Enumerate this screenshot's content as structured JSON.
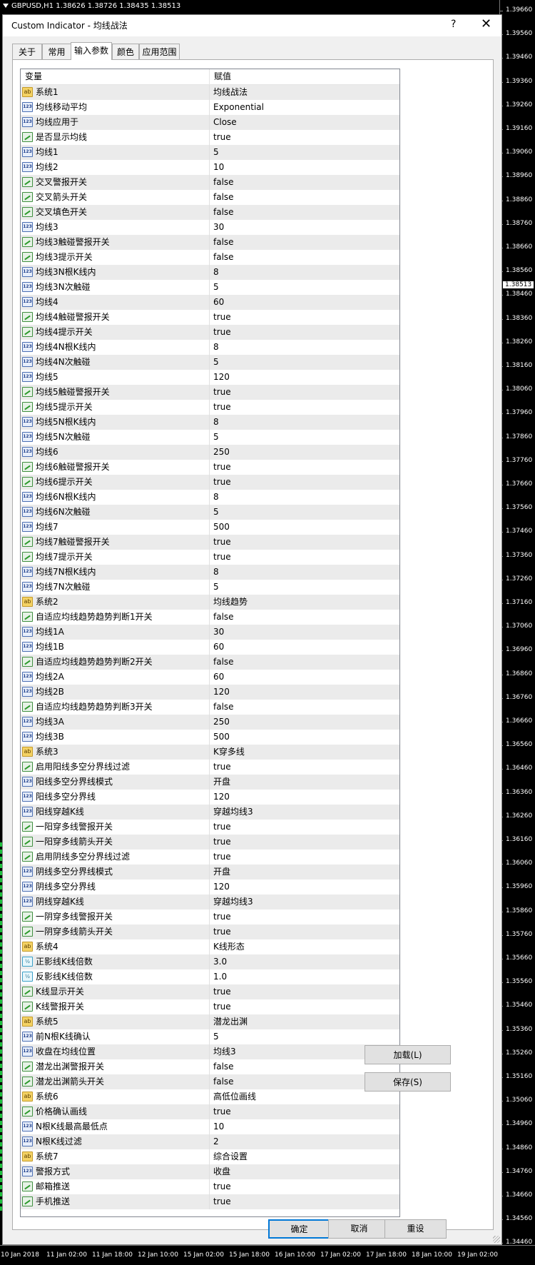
{
  "chart_header": "GBPUSD,H1  1.38626 1.38726 1.38435 1.38513",
  "price_axis": {
    "labels": [
      "1.39660",
      "1.39560",
      "1.39460",
      "1.39360",
      "1.39260",
      "1.39160",
      "1.39060",
      "1.38960",
      "1.38860",
      "1.38760",
      "1.38660",
      "1.38560",
      "1.38460",
      "1.38360",
      "1.38260",
      "1.38160",
      "1.38060",
      "1.37960",
      "1.37860",
      "1.37760",
      "1.37660",
      "1.37560",
      "1.37460",
      "1.37360",
      "1.37260",
      "1.37160",
      "1.37060",
      "1.36960",
      "1.36860",
      "1.36760",
      "1.36660",
      "1.36560",
      "1.36460",
      "1.36360",
      "1.36260",
      "1.36160",
      "1.36060",
      "1.35960",
      "1.35860",
      "1.35760",
      "1.35660",
      "1.35560",
      "1.35460",
      "1.35360",
      "1.35260",
      "1.35160",
      "1.35060",
      "1.34960",
      "1.34860",
      "1.34760",
      "1.34660",
      "1.34560",
      "1.34460"
    ],
    "current": "1.38513"
  },
  "time_axis": [
    "10 Jan 2018",
    "11 Jan 02:00",
    "11 Jan 18:00",
    "12 Jan 10:00",
    "15 Jan 02:00",
    "15 Jan 18:00",
    "16 Jan 10:00",
    "17 Jan 02:00",
    "17 Jan 18:00",
    "18 Jan 10:00",
    "19 Jan 02:00"
  ],
  "dialog": {
    "title": "Custom Indicator - 均线战法",
    "help": "?",
    "close": "✕",
    "tabs": [
      "关于",
      "常用",
      "输入参数",
      "颜色",
      "应用范围"
    ],
    "active_tab": 2,
    "columns": [
      "变量",
      "赋值"
    ],
    "rows": [
      {
        "icon": "ab",
        "name": "系统1",
        "value": "均线战法"
      },
      {
        "icon": "num",
        "name": "均线移动平均",
        "value": "Exponential"
      },
      {
        "icon": "num",
        "name": "均线应用于",
        "value": "Close"
      },
      {
        "icon": "bool",
        "name": "是否显示均线",
        "value": "true"
      },
      {
        "icon": "num",
        "name": "均线1",
        "value": "5"
      },
      {
        "icon": "num",
        "name": "均线2",
        "value": "10"
      },
      {
        "icon": "bool",
        "name": "交叉警报开关",
        "value": "false"
      },
      {
        "icon": "bool",
        "name": "交叉箭头开关",
        "value": "false"
      },
      {
        "icon": "bool",
        "name": "交叉填色开关",
        "value": "false"
      },
      {
        "icon": "num",
        "name": "均线3",
        "value": "30"
      },
      {
        "icon": "bool",
        "name": "均线3触碰警报开关",
        "value": "false"
      },
      {
        "icon": "bool",
        "name": "均线3提示开关",
        "value": "false"
      },
      {
        "icon": "num",
        "name": "均线3N根K线内",
        "value": "8"
      },
      {
        "icon": "num",
        "name": "均线3N次触碰",
        "value": "5"
      },
      {
        "icon": "num",
        "name": "均线4",
        "value": "60"
      },
      {
        "icon": "bool",
        "name": "均线4触碰警报开关",
        "value": "true"
      },
      {
        "icon": "bool",
        "name": "均线4提示开关",
        "value": "true"
      },
      {
        "icon": "num",
        "name": "均线4N根K线内",
        "value": "8"
      },
      {
        "icon": "num",
        "name": "均线4N次触碰",
        "value": "5"
      },
      {
        "icon": "num",
        "name": "均线5",
        "value": "120"
      },
      {
        "icon": "bool",
        "name": "均线5触碰警报开关",
        "value": "true"
      },
      {
        "icon": "bool",
        "name": "均线5提示开关",
        "value": "true"
      },
      {
        "icon": "num",
        "name": "均线5N根K线内",
        "value": "8"
      },
      {
        "icon": "num",
        "name": "均线5N次触碰",
        "value": "5"
      },
      {
        "icon": "num",
        "name": "均线6",
        "value": "250"
      },
      {
        "icon": "bool",
        "name": "均线6触碰警报开关",
        "value": "true"
      },
      {
        "icon": "bool",
        "name": "均线6提示开关",
        "value": "true"
      },
      {
        "icon": "num",
        "name": "均线6N根K线内",
        "value": "8"
      },
      {
        "icon": "num",
        "name": "均线6N次触碰",
        "value": "5"
      },
      {
        "icon": "num",
        "name": "均线7",
        "value": "500"
      },
      {
        "icon": "bool",
        "name": "均线7触碰警报开关",
        "value": "true"
      },
      {
        "icon": "bool",
        "name": "均线7提示开关",
        "value": "true"
      },
      {
        "icon": "num",
        "name": "均线7N根K线内",
        "value": "8"
      },
      {
        "icon": "num",
        "name": "均线7N次触碰",
        "value": "5"
      },
      {
        "icon": "ab",
        "name": "系统2",
        "value": "均线趋势"
      },
      {
        "icon": "bool",
        "name": "自适应均线趋势趋势判断1开关",
        "value": "false"
      },
      {
        "icon": "num",
        "name": "均线1A",
        "value": "30"
      },
      {
        "icon": "num",
        "name": "均线1B",
        "value": "60"
      },
      {
        "icon": "bool",
        "name": "自适应均线趋势趋势判断2开关",
        "value": "false"
      },
      {
        "icon": "num",
        "name": "均线2A",
        "value": "60"
      },
      {
        "icon": "num",
        "name": "均线2B",
        "value": "120"
      },
      {
        "icon": "bool",
        "name": "自适应均线趋势趋势判断3开关",
        "value": "false"
      },
      {
        "icon": "num",
        "name": "均线3A",
        "value": "250"
      },
      {
        "icon": "num",
        "name": "均线3B",
        "value": "500"
      },
      {
        "icon": "ab",
        "name": "系统3",
        "value": "K穿多线"
      },
      {
        "icon": "bool",
        "name": "启用阳线多空分界线过滤",
        "value": "true"
      },
      {
        "icon": "num",
        "name": "阳线多空分界线模式",
        "value": "开盘"
      },
      {
        "icon": "num",
        "name": "阳线多空分界线",
        "value": "120"
      },
      {
        "icon": "num",
        "name": "阳线穿越K线",
        "value": "穿越均线3"
      },
      {
        "icon": "bool",
        "name": "一阳穿多线警报开关",
        "value": "true"
      },
      {
        "icon": "bool",
        "name": "一阳穿多线箭头开关",
        "value": "true"
      },
      {
        "icon": "bool",
        "name": "启用阴线多空分界线过滤",
        "value": "true"
      },
      {
        "icon": "num",
        "name": "阴线多空分界线模式",
        "value": "开盘"
      },
      {
        "icon": "num",
        "name": "阴线多空分界线",
        "value": "120"
      },
      {
        "icon": "num",
        "name": "阴线穿越K线",
        "value": "穿越均线3"
      },
      {
        "icon": "bool",
        "name": "一阴穿多线警报开关",
        "value": "true"
      },
      {
        "icon": "bool",
        "name": "一阴穿多线箭头开关",
        "value": "true"
      },
      {
        "icon": "ab",
        "name": "系统4",
        "value": "K线形态"
      },
      {
        "icon": "frac",
        "name": "正影线K线倍数",
        "value": "3.0"
      },
      {
        "icon": "frac",
        "name": "反影线K线倍数",
        "value": "1.0"
      },
      {
        "icon": "bool",
        "name": "K线显示开关",
        "value": "true"
      },
      {
        "icon": "bool",
        "name": "K线警报开关",
        "value": "true"
      },
      {
        "icon": "ab",
        "name": "系统5",
        "value": "潜龙出渊"
      },
      {
        "icon": "num",
        "name": "前N根K线确认",
        "value": "5"
      },
      {
        "icon": "num",
        "name": "收盘在均线位置",
        "value": "均线3"
      },
      {
        "icon": "bool",
        "name": "潜龙出渊警报开关",
        "value": "false"
      },
      {
        "icon": "bool",
        "name": "潜龙出渊箭头开关",
        "value": "false"
      },
      {
        "icon": "ab",
        "name": "系统6",
        "value": "高低位画线"
      },
      {
        "icon": "bool",
        "name": "价格确认画线",
        "value": "true"
      },
      {
        "icon": "num",
        "name": "N根K线最高最低点",
        "value": "10"
      },
      {
        "icon": "num",
        "name": "N根K线过滤",
        "value": "2"
      },
      {
        "icon": "ab",
        "name": "系统7",
        "value": "综合设置"
      },
      {
        "icon": "num",
        "name": "警报方式",
        "value": "收盘"
      },
      {
        "icon": "bool",
        "name": "邮箱推送",
        "value": "true"
      },
      {
        "icon": "bool",
        "name": "手机推送",
        "value": "true"
      }
    ],
    "icon_glyphs": {
      "ab": "ab",
      "num": "123",
      "bool": "",
      "frac": "½"
    },
    "load_button": "加载(L)",
    "save_button": "保存(S)",
    "ok_button": "确定",
    "cancel_button": "取消",
    "reset_button": "重设"
  }
}
